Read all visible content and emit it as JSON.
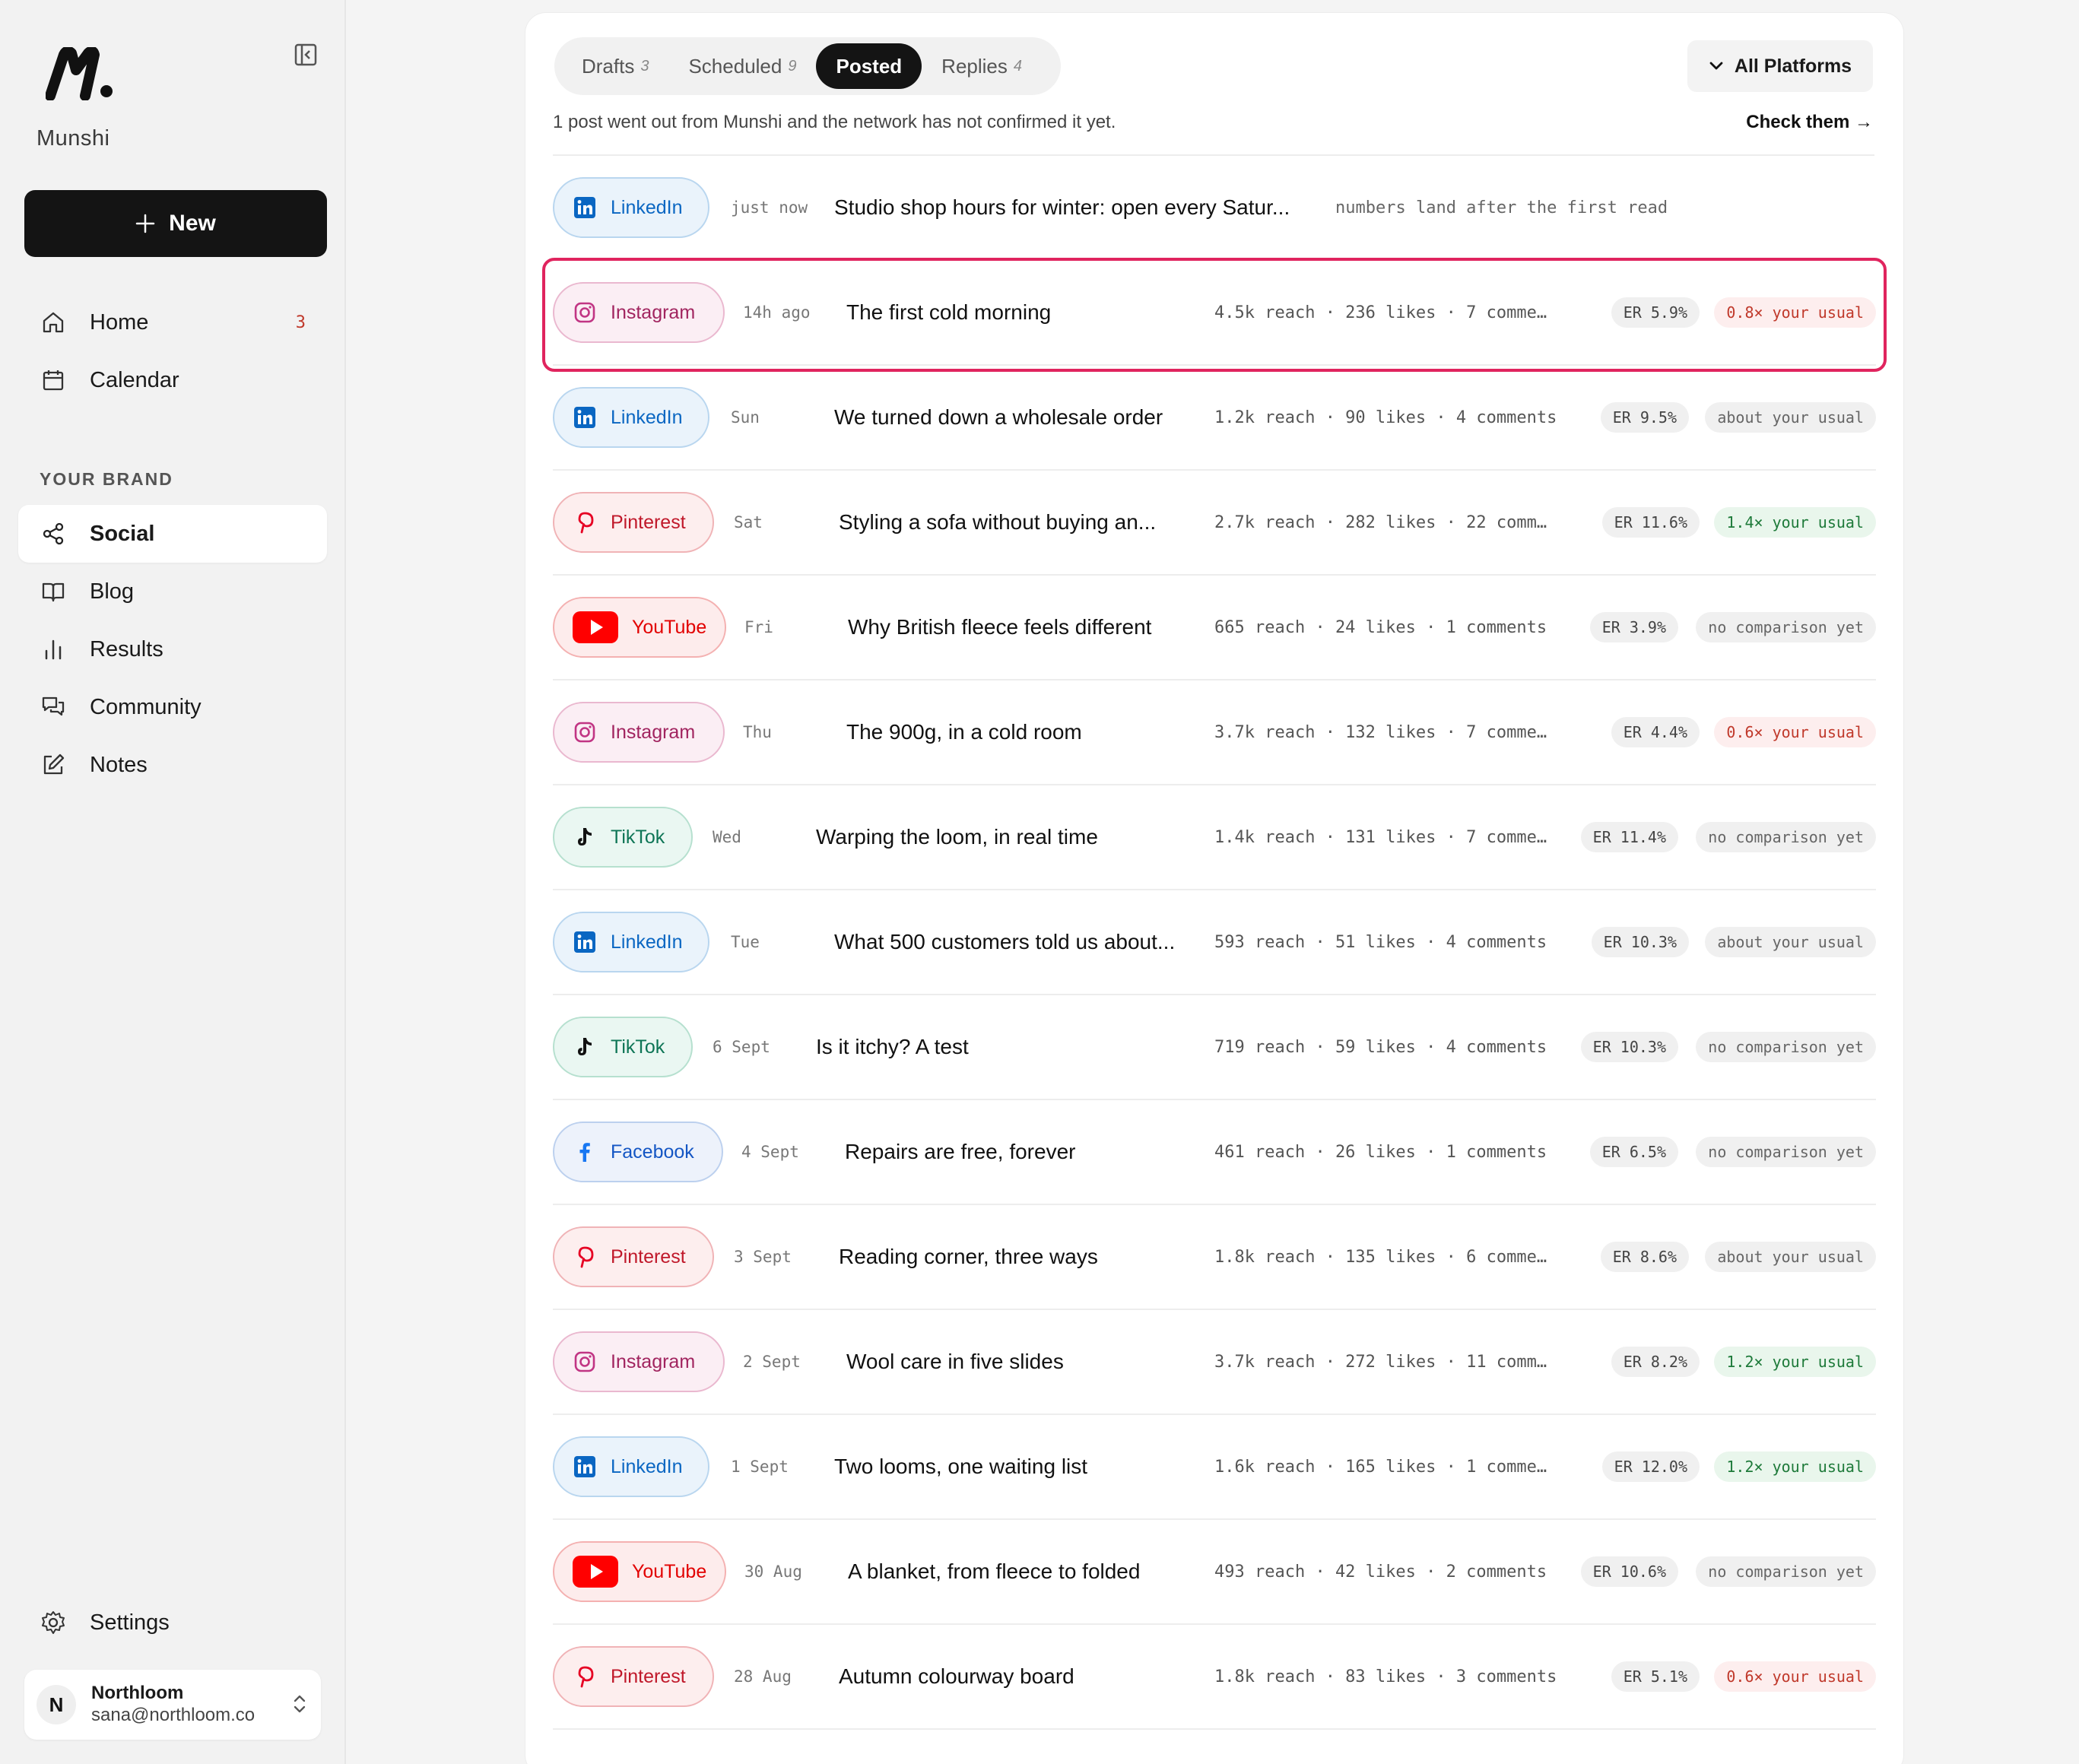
{
  "app": {
    "name": "Munshi"
  },
  "sidebar": {
    "new_label": "New",
    "nav": [
      {
        "label": "Home",
        "icon": "home-icon",
        "badge": "3"
      },
      {
        "label": "Calendar",
        "icon": "calendar-icon",
        "badge": ""
      }
    ],
    "section_title": "YOUR BRAND",
    "brand_nav": [
      {
        "label": "Social",
        "icon": "share-icon",
        "active": true
      },
      {
        "label": "Blog",
        "icon": "book-icon"
      },
      {
        "label": "Results",
        "icon": "bar-chart-icon"
      },
      {
        "label": "Community",
        "icon": "chat-icon"
      },
      {
        "label": "Notes",
        "icon": "edit-icon"
      }
    ],
    "settings_label": "Settings",
    "account": {
      "initial": "N",
      "name": "Northloom",
      "email": "sana@northloom.co"
    }
  },
  "tabs": [
    {
      "label": "Drafts",
      "count": "3"
    },
    {
      "label": "Scheduled",
      "count": "9"
    },
    {
      "label": "Posted",
      "count": "",
      "active": true
    },
    {
      "label": "Replies",
      "count": "4"
    }
  ],
  "filter": {
    "label": "All Platforms"
  },
  "notice": {
    "text": "1 post went out from Munshi and the network has not confirmed it yet.",
    "link": "Check them →"
  },
  "posts": [
    {
      "platform": "LinkedIn",
      "kind": "linkedin",
      "time": "just now",
      "title": "Studio shop hours for winter: open every Satur...",
      "pending": "numbers land after the first read"
    },
    {
      "platform": "Instagram",
      "kind": "instagram",
      "time": "14h ago",
      "title": "The first cold morning",
      "stats": "4.5k reach · 236 likes · 7 comme…",
      "er": "ER 5.9%",
      "cmp": "0.8× your usual",
      "cmp_kind": "low",
      "highlight": true
    },
    {
      "platform": "LinkedIn",
      "kind": "linkedin",
      "time": "Sun",
      "title": "We turned down a wholesale order",
      "stats": "1.2k reach · 90 likes · 4 comments",
      "er": "ER 9.5%",
      "cmp": "about your usual",
      "cmp_kind": "neutral"
    },
    {
      "platform": "Pinterest",
      "kind": "pinterest",
      "time": "Sat",
      "title": "Styling a sofa without buying an...",
      "stats": "2.7k reach · 282 likes · 22 comm…",
      "er": "ER 11.6%",
      "cmp": "1.4× your usual",
      "cmp_kind": "high"
    },
    {
      "platform": "YouTube",
      "kind": "youtube",
      "time": "Fri",
      "title": "Why British fleece feels different",
      "stats": "665 reach · 24 likes · 1 comments",
      "er": "ER 3.9%",
      "cmp": "no comparison yet",
      "cmp_kind": "neutral"
    },
    {
      "platform": "Instagram",
      "kind": "instagram",
      "time": "Thu",
      "title": "The 900g, in a cold room",
      "stats": "3.7k reach · 132 likes · 7 comme…",
      "er": "ER 4.4%",
      "cmp": "0.6× your usual",
      "cmp_kind": "low"
    },
    {
      "platform": "TikTok",
      "kind": "tiktok",
      "time": "Wed",
      "title": "Warping the loom, in real time",
      "stats": "1.4k reach · 131 likes · 7 comme…",
      "er": "ER 11.4%",
      "cmp": "no comparison yet",
      "cmp_kind": "neutral"
    },
    {
      "platform": "LinkedIn",
      "kind": "linkedin",
      "time": "Tue",
      "title": "What 500 customers told us about...",
      "stats": "593 reach · 51 likes · 4 comments",
      "er": "ER 10.3%",
      "cmp": "about your usual",
      "cmp_kind": "neutral"
    },
    {
      "platform": "TikTok",
      "kind": "tiktok",
      "time": "6 Sept",
      "title": "Is it itchy? A test",
      "stats": "719 reach · 59 likes · 4 comments",
      "er": "ER 10.3%",
      "cmp": "no comparison yet",
      "cmp_kind": "neutral"
    },
    {
      "platform": "Facebook",
      "kind": "facebook",
      "time": "4 Sept",
      "title": "Repairs are free, forever",
      "stats": "461 reach · 26 likes · 1 comments",
      "er": "ER 6.5%",
      "cmp": "no comparison yet",
      "cmp_kind": "neutral"
    },
    {
      "platform": "Pinterest",
      "kind": "pinterest",
      "time": "3 Sept",
      "title": "Reading corner, three ways",
      "stats": "1.8k reach · 135 likes · 6 comme…",
      "er": "ER 8.6%",
      "cmp": "about your usual",
      "cmp_kind": "neutral"
    },
    {
      "platform": "Instagram",
      "kind": "instagram",
      "time": "2 Sept",
      "title": "Wool care in five slides",
      "stats": "3.7k reach · 272 likes · 11 comm…",
      "er": "ER 8.2%",
      "cmp": "1.2× your usual",
      "cmp_kind": "high"
    },
    {
      "platform": "LinkedIn",
      "kind": "linkedin",
      "time": "1 Sept",
      "title": "Two looms, one waiting list",
      "stats": "1.6k reach · 165 likes · 1 comme…",
      "er": "ER 12.0%",
      "cmp": "1.2× your usual",
      "cmp_kind": "high"
    },
    {
      "platform": "YouTube",
      "kind": "youtube",
      "time": "30 Aug",
      "title": "A blanket, from fleece to folded",
      "stats": "493 reach · 42 likes · 2 comments",
      "er": "ER 10.6%",
      "cmp": "no comparison yet",
      "cmp_kind": "neutral"
    },
    {
      "platform": "Pinterest",
      "kind": "pinterest",
      "time": "28 Aug",
      "title": "Autumn colourway board",
      "stats": "1.8k reach · 83 likes · 3 comments",
      "er": "ER 5.1%",
      "cmp": "0.6× your usual",
      "cmp_kind": "low"
    }
  ]
}
